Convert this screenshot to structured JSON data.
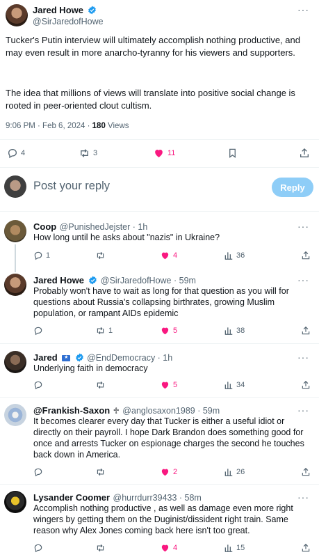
{
  "main_tweet": {
    "name": "Jared Howe",
    "handle": "@SirJaredofHowe",
    "paragraph1": "Tucker's Putin interview will ultimately accomplish nothing productive, and may even result in more anarcho-tyranny for his viewers and supporters.",
    "paragraph2": "The idea that millions of views will translate into positive social change is rooted in peer-oriented clout cultism.",
    "time": "9:06 PM · Feb 6, 2024 · ",
    "views_count": "180",
    "views_label": " Views",
    "replies": "4",
    "retweets": "3",
    "likes": "11"
  },
  "reply_box": {
    "placeholder": "Post your reply",
    "button": "Reply"
  },
  "replies": [
    {
      "name": "Coop",
      "handle": "@PunishedJejster · 1h",
      "text": "How long until he asks about \"nazis\" in Ukraine?",
      "replies": "1",
      "retweets": "",
      "likes": "4",
      "views": "36"
    },
    {
      "name": "Jared Howe",
      "handle": "@SirJaredofHowe · 59m",
      "text": "Probably won't have to wait as long for that question as you will for questions about Russia's collapsing birthrates, growing Muslim population, or rampant AIDs epidemic",
      "replies": "",
      "retweets": "1",
      "likes": "5",
      "views": "38"
    },
    {
      "name": "Jared",
      "handle": "@EndDemocracy · 1h",
      "text": "Underlying faith in democracy",
      "replies": "",
      "retweets": "",
      "likes": "5",
      "views": "34"
    },
    {
      "name": "@Frankish-Saxon",
      "name_glyph": "♱",
      "handle": "@anglosaxon1989 · 59m",
      "text": "It becomes clearer every day that Tucker is either a useful idiot or directly on their payroll. I hope Dark Brandon does something good for once and arrests Tucker on espionage charges the second he touches back down in America.",
      "replies": "",
      "retweets": "",
      "likes": "2",
      "views": "26"
    },
    {
      "name": "Lysander Coomer",
      "handle": "@hurrdurr39433 · 58m",
      "text": "Accomplish nothing productive , as well as damage even more right wingers by getting them on the Duginist/dissident right train. Same reason why Alex Jones coming back here isn't too great.",
      "replies": "",
      "retweets": "",
      "likes": "4",
      "views": "15"
    }
  ],
  "more_label": "···",
  "colors": {
    "verified": "#1d9bf0",
    "like": "#f91880",
    "reply_button": "#8ecdf7",
    "muted": "#536471",
    "flag_badge": "#2f6fd1"
  }
}
